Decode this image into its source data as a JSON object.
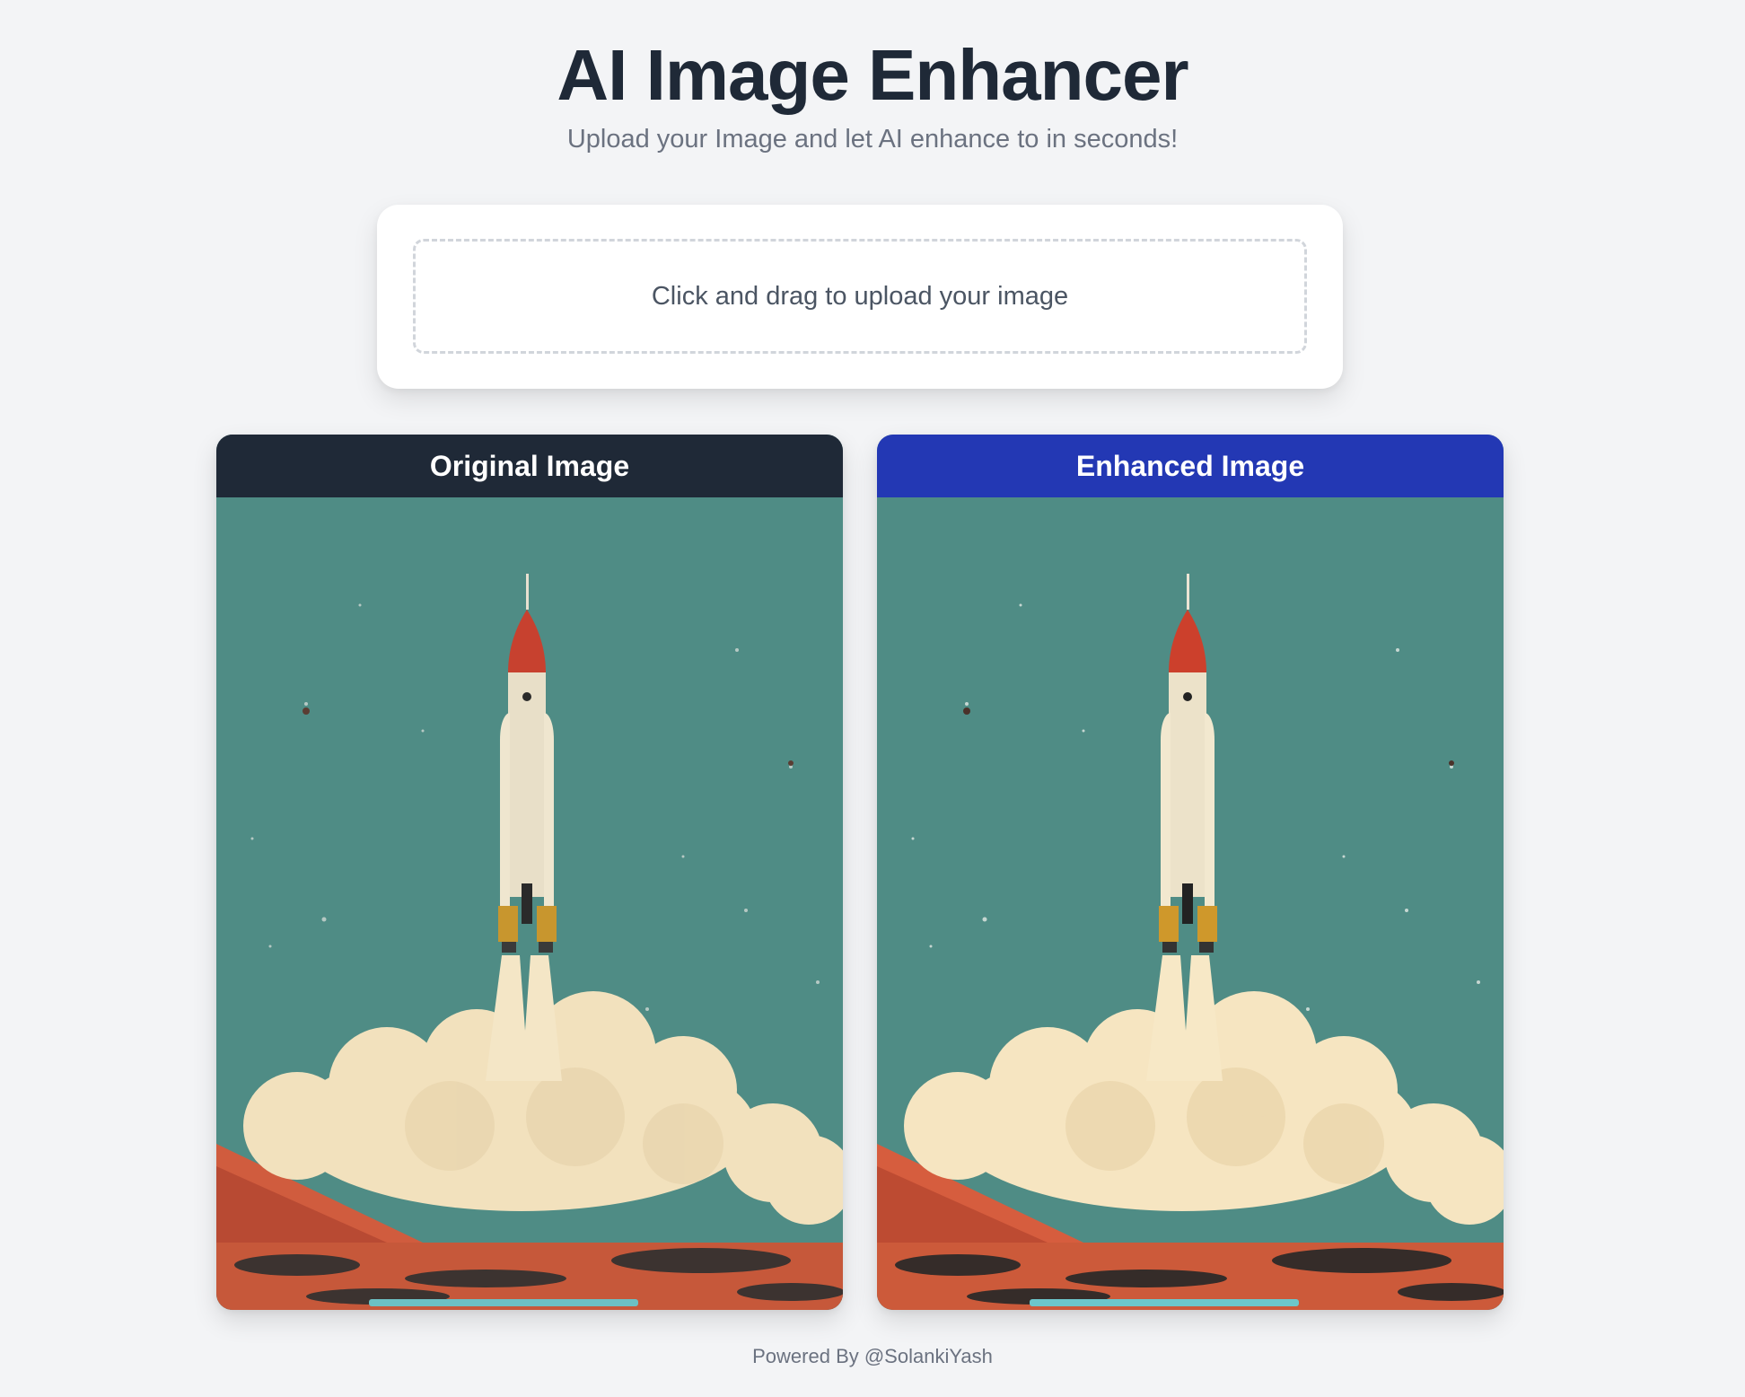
{
  "header": {
    "title": "AI Image Enhancer",
    "subtitle": "Upload your Image and let AI enhance to in seconds!"
  },
  "upload": {
    "prompt": "Click and drag to upload your image"
  },
  "panels": {
    "original": {
      "title": "Original Image"
    },
    "enhanced": {
      "title": "Enhanced Image"
    }
  },
  "footer": {
    "text": "Powered By @SolankiYash"
  },
  "colors": {
    "background": "#f3f4f6",
    "title": "#1f2937",
    "original_header": "#1f2937",
    "enhanced_header": "#2338b4",
    "sky": "#4f8c85"
  },
  "image_subject": "rocket-launch-illustration"
}
